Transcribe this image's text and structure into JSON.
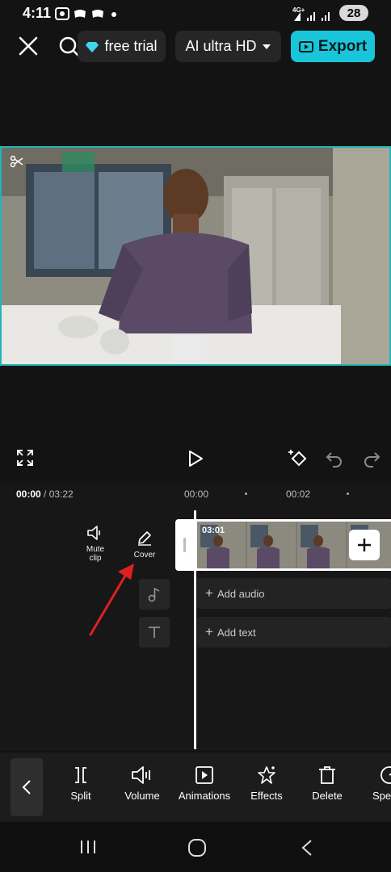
{
  "status": {
    "time": "4:11",
    "network": "4G+",
    "battery": "28"
  },
  "header": {
    "trial_label": "free trial",
    "quality_label": "AI ultra HD",
    "export_label": "Export"
  },
  "ruler": {
    "current": "00:00",
    "total": " / 03:22",
    "marks": [
      "00:00",
      "00:02"
    ]
  },
  "timeline": {
    "mute_label": "Mute\nclip",
    "cover_label": "Cover",
    "clip_duration": "03:01",
    "add_audio": "Add audio",
    "add_text": "Add text"
  },
  "toolbar": {
    "items": [
      {
        "label": "Split",
        "icon": "split-icon"
      },
      {
        "label": "Volume",
        "icon": "volume-icon"
      },
      {
        "label": "Animations",
        "icon": "animations-icon"
      },
      {
        "label": "Effects",
        "icon": "effects-icon"
      },
      {
        "label": "Delete",
        "icon": "delete-icon"
      },
      {
        "label": "Spe",
        "icon": "speed-icon"
      }
    ]
  },
  "colors": {
    "accent": "#19c5d9",
    "preview_border": "#1fb6b8",
    "annotation_arrow": "#e02020"
  }
}
